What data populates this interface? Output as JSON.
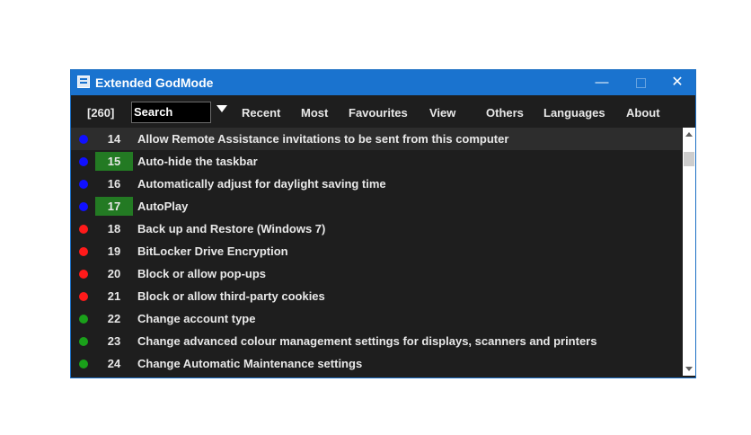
{
  "window": {
    "title": "Extended GodMode",
    "minimize_glyph": "—",
    "close_glyph": "✕"
  },
  "toolbar": {
    "count": "[260]",
    "search_value": "Search",
    "menus": [
      "Recent",
      "Most",
      "Favourites",
      "View",
      "Others",
      "Languages",
      "About"
    ]
  },
  "colors": {
    "blue": "#1010ff",
    "red": "#ff1a1a",
    "green": "#1aa01a",
    "highlight": "#237a23",
    "titlebar": "#1a73cf"
  },
  "items": [
    {
      "num": "14",
      "label": "Allow Remote Assistance invitations to be sent from this computer",
      "dot": "blue"
    },
    {
      "num": "15",
      "label": "Auto-hide the taskbar",
      "dot": "blue"
    },
    {
      "num": "16",
      "label": "Automatically adjust for daylight saving time",
      "dot": "blue"
    },
    {
      "num": "17",
      "label": "AutoPlay",
      "dot": "blue"
    },
    {
      "num": "18",
      "label": "Back up and Restore (Windows 7)",
      "dot": "red"
    },
    {
      "num": "19",
      "label": "BitLocker Drive Encryption",
      "dot": "red"
    },
    {
      "num": "20",
      "label": "Block or allow pop-ups",
      "dot": "red"
    },
    {
      "num": "21",
      "label": "Block or allow third-party cookies",
      "dot": "red"
    },
    {
      "num": "22",
      "label": "Change account type",
      "dot": "green"
    },
    {
      "num": "23",
      "label": "Change advanced colour management settings for displays, scanners and printers",
      "dot": "green"
    },
    {
      "num": "24",
      "label": "Change Automatic Maintenance settings",
      "dot": "green"
    }
  ]
}
